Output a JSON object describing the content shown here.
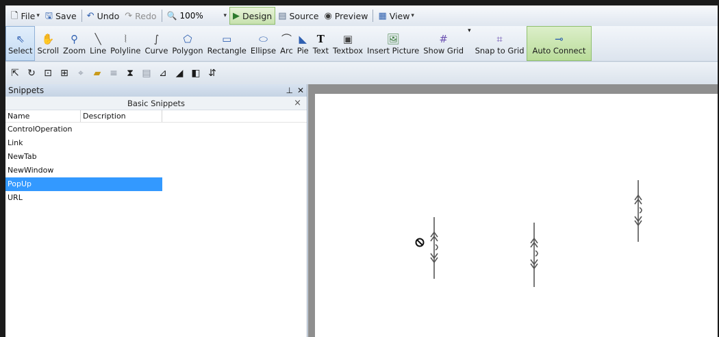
{
  "toolbar_top": {
    "file": "File",
    "save": "Save",
    "undo": "Undo",
    "redo": "Redo",
    "zoom": "100%",
    "design": "Design",
    "source": "Source",
    "preview": "Preview",
    "view": "View"
  },
  "tools": [
    {
      "label": "Select",
      "icon": "pointer-arrow-icon"
    },
    {
      "label": "Scroll",
      "icon": "hand-icon"
    },
    {
      "label": "Zoom",
      "icon": "magnifier-icon"
    },
    {
      "label": "Line",
      "icon": "line-icon"
    },
    {
      "label": "Polyline",
      "icon": "polyline-icon"
    },
    {
      "label": "Curve",
      "icon": "curve-icon"
    },
    {
      "label": "Polygon",
      "icon": "polygon-icon"
    },
    {
      "label": "Rectangle",
      "icon": "rectangle-icon"
    },
    {
      "label": "Ellipse",
      "icon": "ellipse-icon"
    },
    {
      "label": "Arc",
      "icon": "arc-icon"
    },
    {
      "label": "Pie",
      "icon": "pie-icon"
    },
    {
      "label": "Text",
      "icon": "text-icon"
    },
    {
      "label": "Textbox",
      "icon": "textbox-icon"
    },
    {
      "label": "Insert Picture",
      "icon": "picture-icon"
    },
    {
      "label": "Show Grid",
      "icon": "grid-icon"
    },
    {
      "label": "Snap to Grid",
      "icon": "snap-grid-icon"
    },
    {
      "label": "Auto Connect",
      "icon": "connect-icon"
    }
  ],
  "snippets": {
    "panel_title": "Snippets",
    "group_title": "Basic Snippets",
    "columns": [
      "Name",
      "Description"
    ],
    "items": [
      "ControlOperation",
      "Link",
      "NewTab",
      "NewWindow",
      "PopUp",
      "URL"
    ],
    "selected": "PopUp"
  },
  "colors": {
    "accent_green": "#b9dc9a",
    "selection_blue": "#3399ff",
    "canvas_border": "#8f8f8f"
  }
}
